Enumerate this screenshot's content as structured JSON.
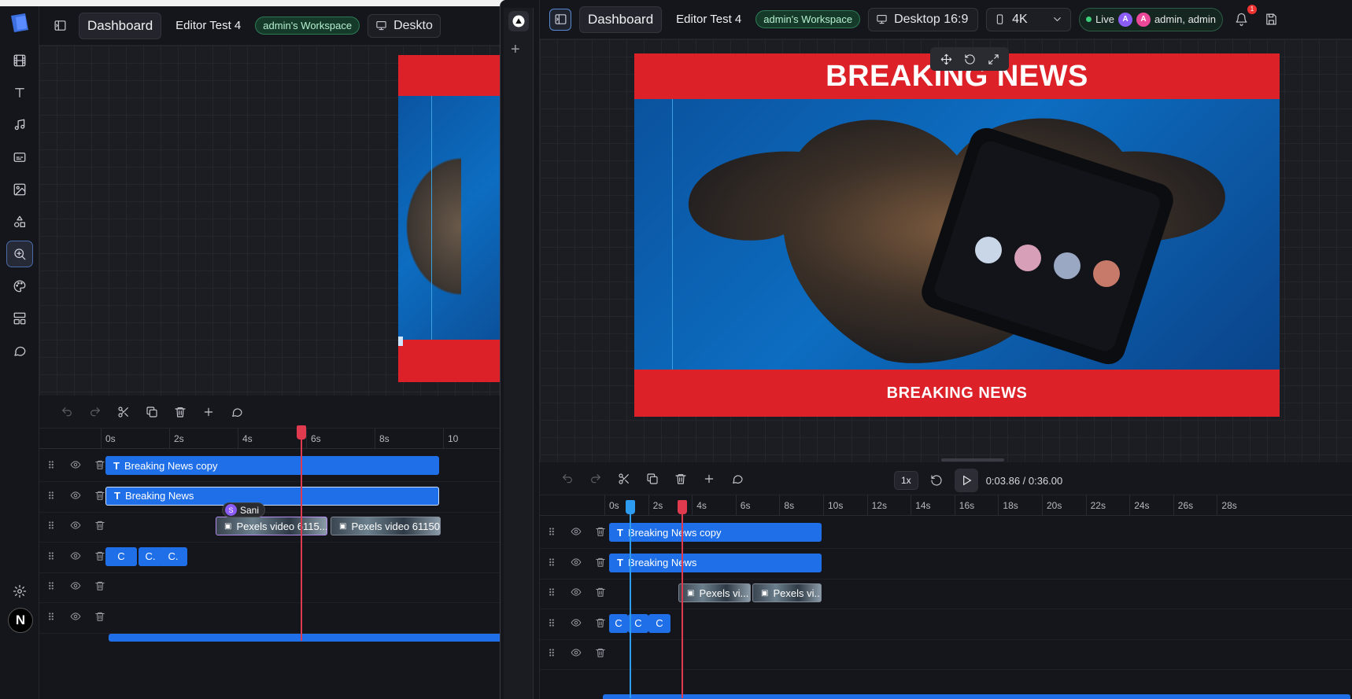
{
  "left": {
    "header": {
      "dashboard_label": "Dashboard",
      "project_name": "Editor Test 4",
      "workspace": "admin's Workspace",
      "device": "Deskto"
    },
    "ruler": [
      "0s",
      "2s",
      "4s",
      "6s",
      "8s",
      "10"
    ],
    "tracks": [
      {
        "clips": [
          {
            "label": "Breaking News copy",
            "kind": "text"
          }
        ]
      },
      {
        "clips": [
          {
            "label": "Breaking News",
            "kind": "text"
          }
        ]
      },
      {
        "clips": [
          {
            "label": "Pexels video 6115...",
            "kind": "video"
          },
          {
            "label": "Pexels video 61150...",
            "kind": "video"
          }
        ]
      },
      {
        "clips": [
          {
            "label": "C",
            "kind": "caption"
          },
          {
            "label": "C.",
            "kind": "caption"
          },
          {
            "label": "C.",
            "kind": "caption"
          }
        ]
      },
      {
        "clips": []
      },
      {
        "clips": []
      }
    ],
    "collaborator": {
      "initial": "S",
      "name": "Sani"
    }
  },
  "strip": {
    "logo": "triangle-icon",
    "add": "+"
  },
  "right": {
    "header": {
      "dashboard_label": "Dashboard",
      "project_name": "Editor Test 4",
      "workspace": "admin's Workspace",
      "device": "Desktop 16:9",
      "resolution": "4K",
      "live_label": "Live",
      "avatars": [
        "A",
        "A"
      ],
      "users": "admin, admin",
      "notification_count": "1"
    },
    "canvas": {
      "top_banner": "BREAKING NEWS",
      "bottom_banner": "BREAKING NEWS"
    },
    "playback": {
      "speed": "1x",
      "time": "0:03.86 / 0:36.00"
    },
    "ruler": [
      "0s",
      "2s",
      "4s",
      "6s",
      "8s",
      "10s",
      "12s",
      "14s",
      "16s",
      "18s",
      "20s",
      "22s",
      "24s",
      "26s",
      "28s"
    ],
    "tracks": [
      {
        "clips": [
          {
            "label": "Breaking News copy",
            "kind": "text"
          }
        ]
      },
      {
        "clips": [
          {
            "label": "Breaking News",
            "kind": "text"
          }
        ]
      },
      {
        "clips": [
          {
            "label": "Pexels vi...",
            "kind": "video"
          },
          {
            "label": "Pexels vi...",
            "kind": "video"
          }
        ]
      },
      {
        "clips": [
          {
            "label": "C",
            "kind": "caption"
          },
          {
            "label": "C",
            "kind": "caption"
          },
          {
            "label": "C",
            "kind": "caption"
          }
        ]
      },
      {
        "clips": []
      }
    ]
  },
  "sidebar_icons": [
    "film-icon",
    "text-icon",
    "music-icon",
    "caption-icon",
    "image-icon",
    "shapes-icon",
    "zoom-icon",
    "palette-icon",
    "layout-icon",
    "comment-icon"
  ],
  "avatar_initial": "N",
  "colors": {
    "accent": "#1f6fe8",
    "banner": "#dc2128",
    "playhead": "#e03a4f"
  }
}
